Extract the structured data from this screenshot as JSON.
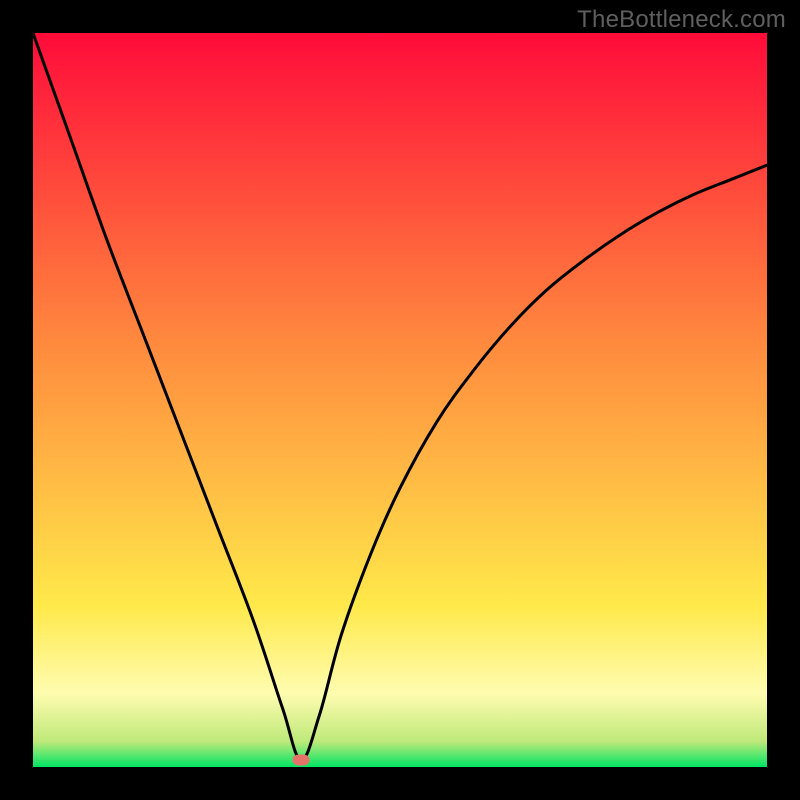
{
  "branding": "TheBottleneck.com",
  "colors": {
    "top": "#ff0b3a",
    "mid1": "#ff893e",
    "mid2": "#ffe94a",
    "band": "#fffcb0",
    "green": "#00e565",
    "marker": "#e57369",
    "curve": "#000000",
    "frame": "#000000"
  },
  "chart_data": {
    "type": "line",
    "title": "",
    "xlabel": "",
    "ylabel": "",
    "xlim": [
      0,
      100
    ],
    "ylim": [
      0,
      100
    ],
    "series": [
      {
        "name": "curve",
        "x": [
          0,
          5,
          10,
          15,
          20,
          25,
          30,
          34,
          36.5,
          39,
          42,
          46,
          50,
          55,
          60,
          65,
          70,
          75,
          80,
          85,
          90,
          95,
          100
        ],
        "values": [
          100,
          86,
          72,
          59,
          46,
          33,
          20,
          8,
          1,
          7,
          18,
          29,
          38,
          47,
          54,
          60,
          65,
          69,
          72.5,
          75.5,
          78,
          80,
          82
        ]
      }
    ],
    "marker": {
      "x": 36.5,
      "y": 1
    },
    "gradient_stops": [
      {
        "pos": 0.0,
        "color": "#ff0b3a"
      },
      {
        "pos": 0.42,
        "color": "#ff893e"
      },
      {
        "pos": 0.78,
        "color": "#ffe94a"
      },
      {
        "pos": 0.9,
        "color": "#fffcb0"
      },
      {
        "pos": 0.965,
        "color": "#bfe97a"
      },
      {
        "pos": 1.0,
        "color": "#00e565"
      }
    ]
  }
}
